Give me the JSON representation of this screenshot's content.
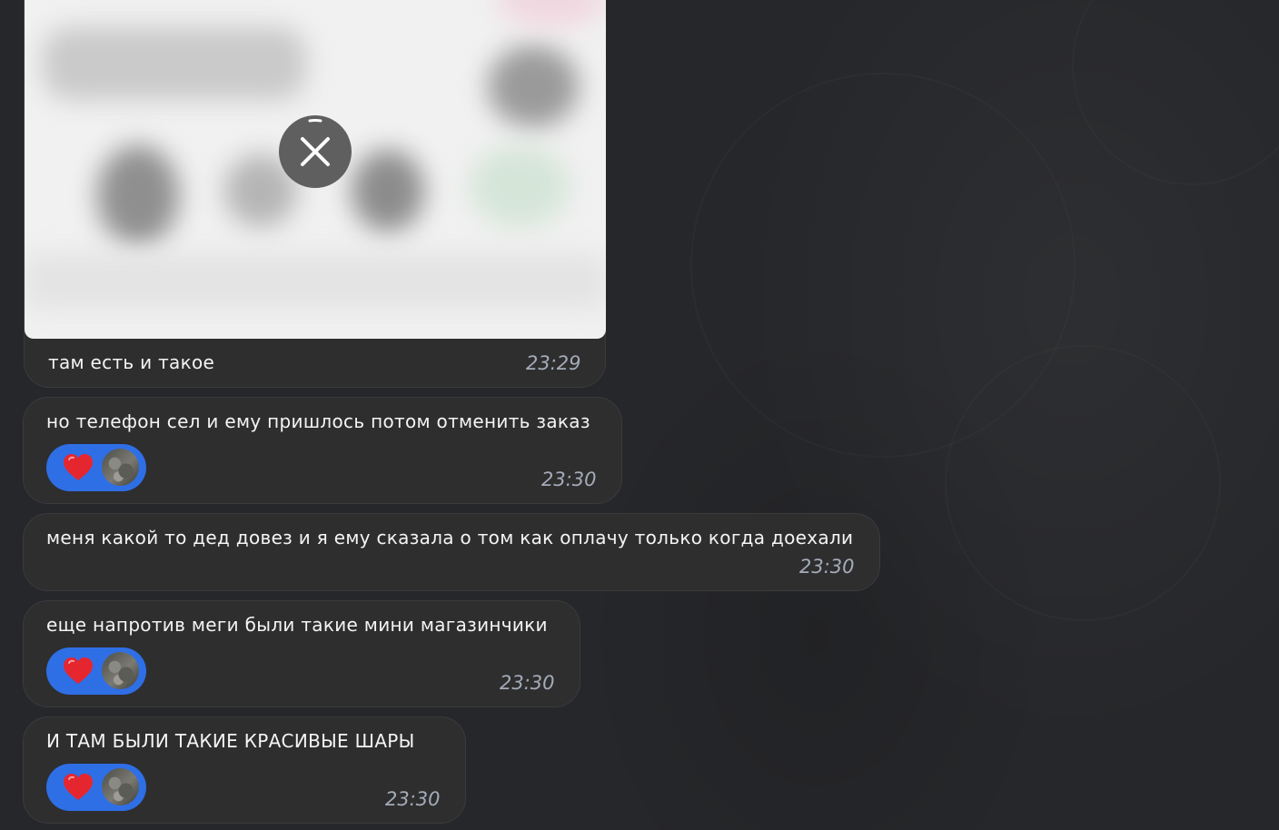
{
  "chat": {
    "messages": [
      {
        "kind": "media",
        "caption": "там есть и такое",
        "time": "23:29",
        "media_action": "close-icon"
      },
      {
        "kind": "text",
        "text": "но телефон сел и ему пришлось потом отменить заказ",
        "time": "23:30",
        "reaction": {
          "emoji": "heart",
          "count_shown_as": "avatar"
        }
      },
      {
        "kind": "text",
        "text": "меня какой то дед довез и я ему сказала о том как оплачу только когда доехали",
        "time": "23:30"
      },
      {
        "kind": "text",
        "text": "еще напротив меги были такие мини магазинчики",
        "time": "23:30",
        "reaction": {
          "emoji": "heart",
          "count_shown_as": "avatar"
        }
      },
      {
        "kind": "text",
        "text": "И ТАМ БЫЛИ ТАКИЕ КРАСИВЫЕ ШАРЫ",
        "time": "23:30",
        "reaction": {
          "emoji": "heart",
          "count_shown_as": "avatar"
        }
      }
    ]
  },
  "colors": {
    "background": "#26272a",
    "bubble": "#2e2e2f",
    "reaction": "#2f6fe6",
    "time": "#a4abb8",
    "heart": "#e5262e"
  }
}
